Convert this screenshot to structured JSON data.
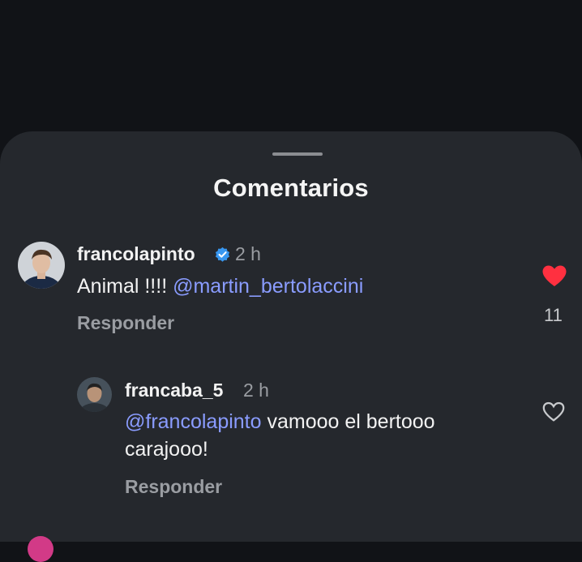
{
  "sheet": {
    "title": "Comentarios"
  },
  "comments": [
    {
      "username": "francolapinto",
      "verified": true,
      "time": "2 h",
      "text_prefix": "Animal !!!! ",
      "mention": "@martin_bertolaccini",
      "reply_label": "Responder",
      "liked": true,
      "like_count": "11"
    },
    {
      "username": "francaba_5",
      "verified": false,
      "time": "2 h",
      "mention": "@francolapinto",
      "text_line1_suffix": " vamooo el bertooo",
      "text_line2": "carajooo!",
      "reply_label": "Responder",
      "liked": false
    }
  ],
  "icons": {
    "verified": "verified-badge-icon",
    "like_filled": "heart-filled-icon",
    "like_outline": "heart-outline-icon"
  },
  "colors": {
    "background": "#111317",
    "sheet": "#25282d",
    "mention": "#8a9cff",
    "like_red": "#ff3040",
    "verified_blue": "#3897f0"
  }
}
